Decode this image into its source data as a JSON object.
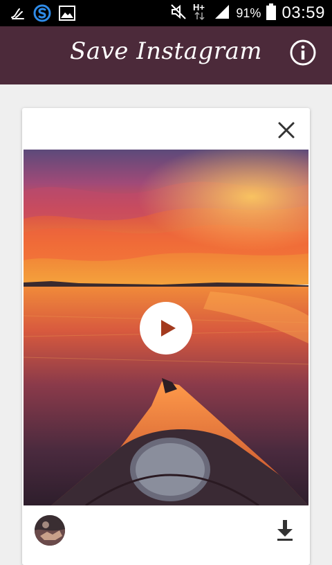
{
  "status_bar": {
    "battery_percent": "91%",
    "time": "03:59",
    "network_type": "H+",
    "icons": [
      "sound-wave-icon",
      "s-app-icon",
      "gallery-icon",
      "mute-icon",
      "network-hplus-icon",
      "signal-icon",
      "battery-icon"
    ]
  },
  "app_bar": {
    "title": "Save Instagram",
    "info_icon": "info-icon",
    "background": "#4c2a3a"
  },
  "card": {
    "close_icon": "close-icon",
    "media": {
      "type": "video",
      "play_icon": "play-icon"
    },
    "footer": {
      "avatar_icon": "avatar",
      "download_icon": "download-icon"
    }
  }
}
